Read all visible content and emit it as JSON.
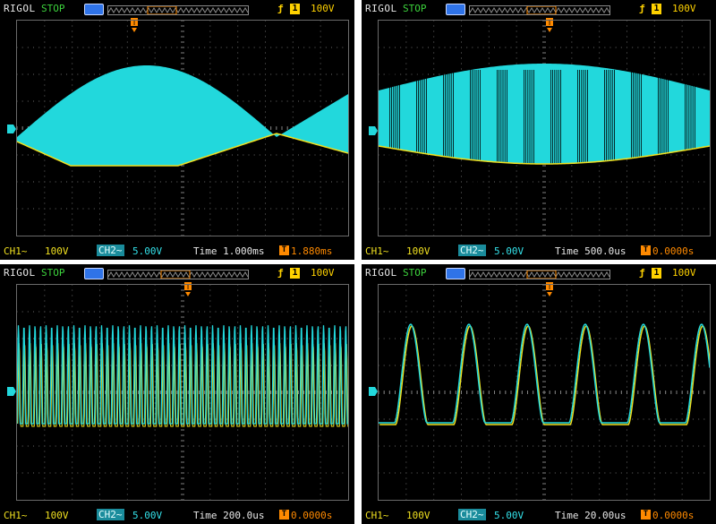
{
  "colors": {
    "ch1": "#f0e020",
    "ch2": "#22d8dc",
    "trigger": "#ff8a00",
    "grid": "#5a5a5a",
    "background": "#000000"
  },
  "panels": [
    {
      "brand": "RIGOL",
      "status": "STOP",
      "trigger_type_icon": "ƒ",
      "trigger_channel": "1",
      "trigger_level": "100V",
      "ch1_label": "CH1~",
      "ch1_scale": "100V",
      "ch2_label": "CH2~",
      "ch2_scale": "5.00V",
      "timebase": "Time 1.000ms",
      "trigger_offset": "1.880ms"
    },
    {
      "brand": "RIGOL",
      "status": "STOP",
      "trigger_type_icon": "ƒ",
      "trigger_channel": "1",
      "trigger_level": "100V",
      "ch1_label": "CH1~",
      "ch1_scale": "100V",
      "ch2_label": "CH2~",
      "ch2_scale": "5.00V",
      "timebase": "Time 500.0us",
      "trigger_offset": "0.0000s"
    },
    {
      "brand": "RIGOL",
      "status": "STOP",
      "trigger_type_icon": "ƒ",
      "trigger_channel": "1",
      "trigger_level": "100V",
      "ch1_label": "CH1~",
      "ch1_scale": "100V",
      "ch2_label": "CH2~",
      "ch2_scale": "5.00V",
      "timebase": "Time 200.0us",
      "trigger_offset": "0.0000s"
    },
    {
      "brand": "RIGOL",
      "status": "STOP",
      "trigger_type_icon": "ƒ",
      "trigger_channel": "1",
      "trigger_level": "100V",
      "ch1_label": "CH1~",
      "ch1_scale": "100V",
      "ch2_label": "CH2~",
      "ch2_scale": "5.00V",
      "timebase": "Time 20.00us",
      "trigger_offset": "0.0000s"
    }
  ]
}
